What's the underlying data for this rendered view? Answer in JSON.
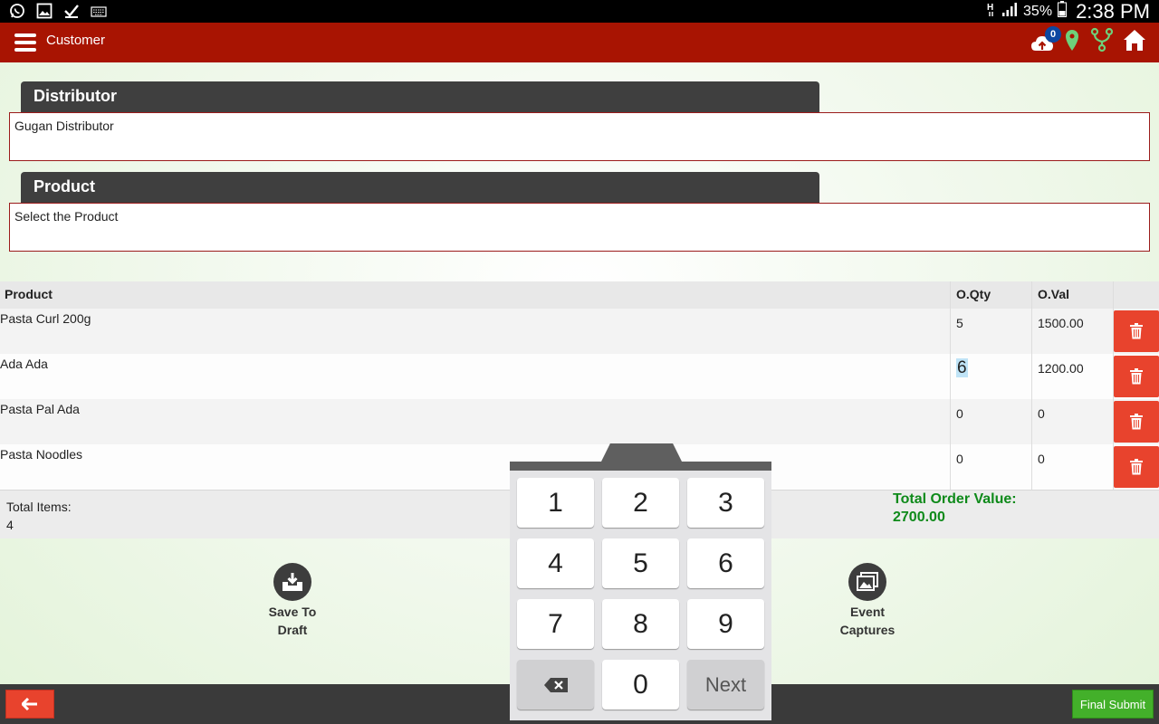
{
  "status_bar": {
    "battery": "35%",
    "time": "2:38 PM"
  },
  "app_bar": {
    "title": "Customer",
    "sync_count": "0"
  },
  "distributor": {
    "header": "Distributor",
    "value": "Gugan Distributor"
  },
  "product": {
    "header": "Product",
    "value": "Select the Product"
  },
  "table": {
    "headers": {
      "product": "Product",
      "qty": "O.Qty",
      "val": "O.Val"
    },
    "rows": [
      {
        "product": "Pasta Curl 200g",
        "qty": "5",
        "val": "1500.00"
      },
      {
        "product": "Ada Ada",
        "qty": "6",
        "val": "1200.00"
      },
      {
        "product": "Pasta Pal Ada",
        "qty": "0",
        "val": "0"
      },
      {
        "product": "Pasta Noodles",
        "qty": "0",
        "val": "0"
      }
    ]
  },
  "totals": {
    "items_label": "Total Items:",
    "items_value": "4",
    "order_label": "Total Order Value:",
    "order_value": "2700.00"
  },
  "actions": {
    "save_draft_line1": "Save To",
    "save_draft_line2": "Draft",
    "event_line1": "Event",
    "event_line2": "Captures"
  },
  "keypad": {
    "keys": [
      "1",
      "2",
      "3",
      "4",
      "5",
      "6",
      "7",
      "8",
      "9"
    ],
    "zero": "0",
    "next": "Next"
  },
  "bottom_bar": {
    "submit": "Final Submit"
  },
  "colors": {
    "app_bar": "#a81402",
    "delete": "#e8432d",
    "submit": "#43b02a",
    "total_green": "#0e8a1a"
  }
}
